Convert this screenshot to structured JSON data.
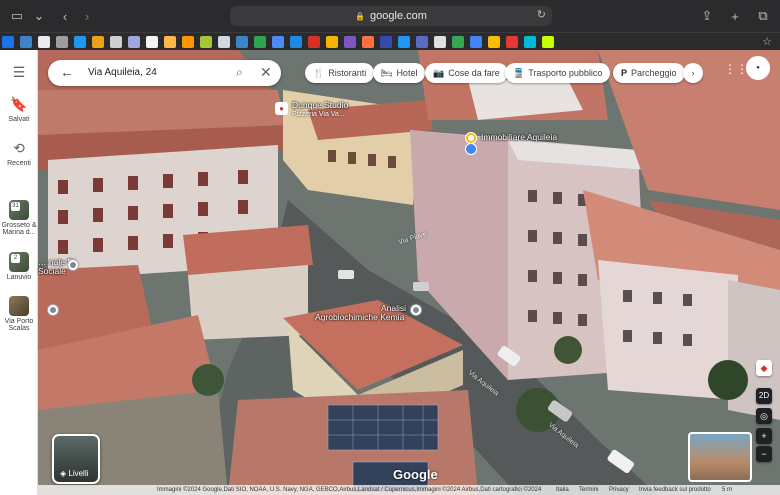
{
  "browser": {
    "url": "google.com",
    "lock": "🔒",
    "icons": [
      "sidebar-icon",
      "chevron-down-icon",
      "back-icon",
      "forward-icon",
      "reload-icon",
      "share-icon",
      "new-tab-icon",
      "tab-overview-icon"
    ]
  },
  "bookmarks": {
    "colors": [
      "#1a73e8",
      "#3d85c6",
      "#e8eaed",
      "#9e9e9e",
      "#2196f3",
      "#e8a317",
      "#cfcfcf",
      "#9fa8da",
      "#f4f4f4",
      "#ffb74d",
      "#ff9800",
      "#a8c53a",
      "#d0d8e0",
      "#3d85c6",
      "#2ea44f",
      "#4c8bf5",
      "#1e88e5",
      "#d93025",
      "#f4b400",
      "#7e57c2",
      "#ff7043",
      "#3949ab",
      "#2196f3",
      "#5c6bc0",
      "#e0e0e0",
      "#34a853",
      "#4285f4",
      "#fbbc04",
      "#e53935",
      "#00bcd4",
      "#c6ff00"
    ]
  },
  "search": {
    "value": "Via Aquileia, 24",
    "back_icon": "←",
    "search_icon": "⌕",
    "clear_icon": "✕"
  },
  "chips": [
    {
      "label": "Ristoranti",
      "icon": "🍴"
    },
    {
      "label": "Hotel",
      "icon": "🛏"
    },
    {
      "label": "Cose da fare",
      "icon": "📷"
    },
    {
      "label": "Trasporto pubblico",
      "icon": "🚆"
    },
    {
      "label": "Parcheggio",
      "icon": "P"
    }
  ],
  "chip_next": "›",
  "rail": {
    "menu": "☰",
    "saved": "Salvati",
    "recent": "Recenti",
    "recent_places": [
      {
        "label": "Grosseto & Marina d...",
        "count": "31"
      },
      {
        "label": "Lanuvio",
        "count": "2"
      },
      {
        "label": "Via Porto Scalas",
        "count": ""
      }
    ]
  },
  "map_labels": {
    "dunque": "Dunque Studio",
    "dunque_sub": "Pizzeria Via Va...",
    "immobiliare": "Immobiliare Aquileia",
    "sociale": "... nale Di\nSociale",
    "analisi_1": "Analisi",
    "analisi_2": "Agrobiochimiche Kemia",
    "street_piave": "Via Piave",
    "street_aquileia": "Via Aquileia",
    "street_aquileia_2": "Via Aquileia"
  },
  "layers_label": "Livelli",
  "controls": {
    "compass": "◆",
    "mode": "2D",
    "locate": "◎",
    "zoom_in": "+",
    "zoom_out": "−"
  },
  "google_logo": "Google",
  "attribution": {
    "text": "Immagini ©2024 Google,Dati SIO, NOAA, U.S. Navy, NGA, GEBCO,Airbus,Landsat / Copernicus,Immagini ©2024 Airbus,Dati cartografici ©2024",
    "country": "Italia",
    "terms": "Termini",
    "privacy": "Privacy",
    "feedback": "Invia feedback sul prodotto",
    "scale": "5 m"
  }
}
